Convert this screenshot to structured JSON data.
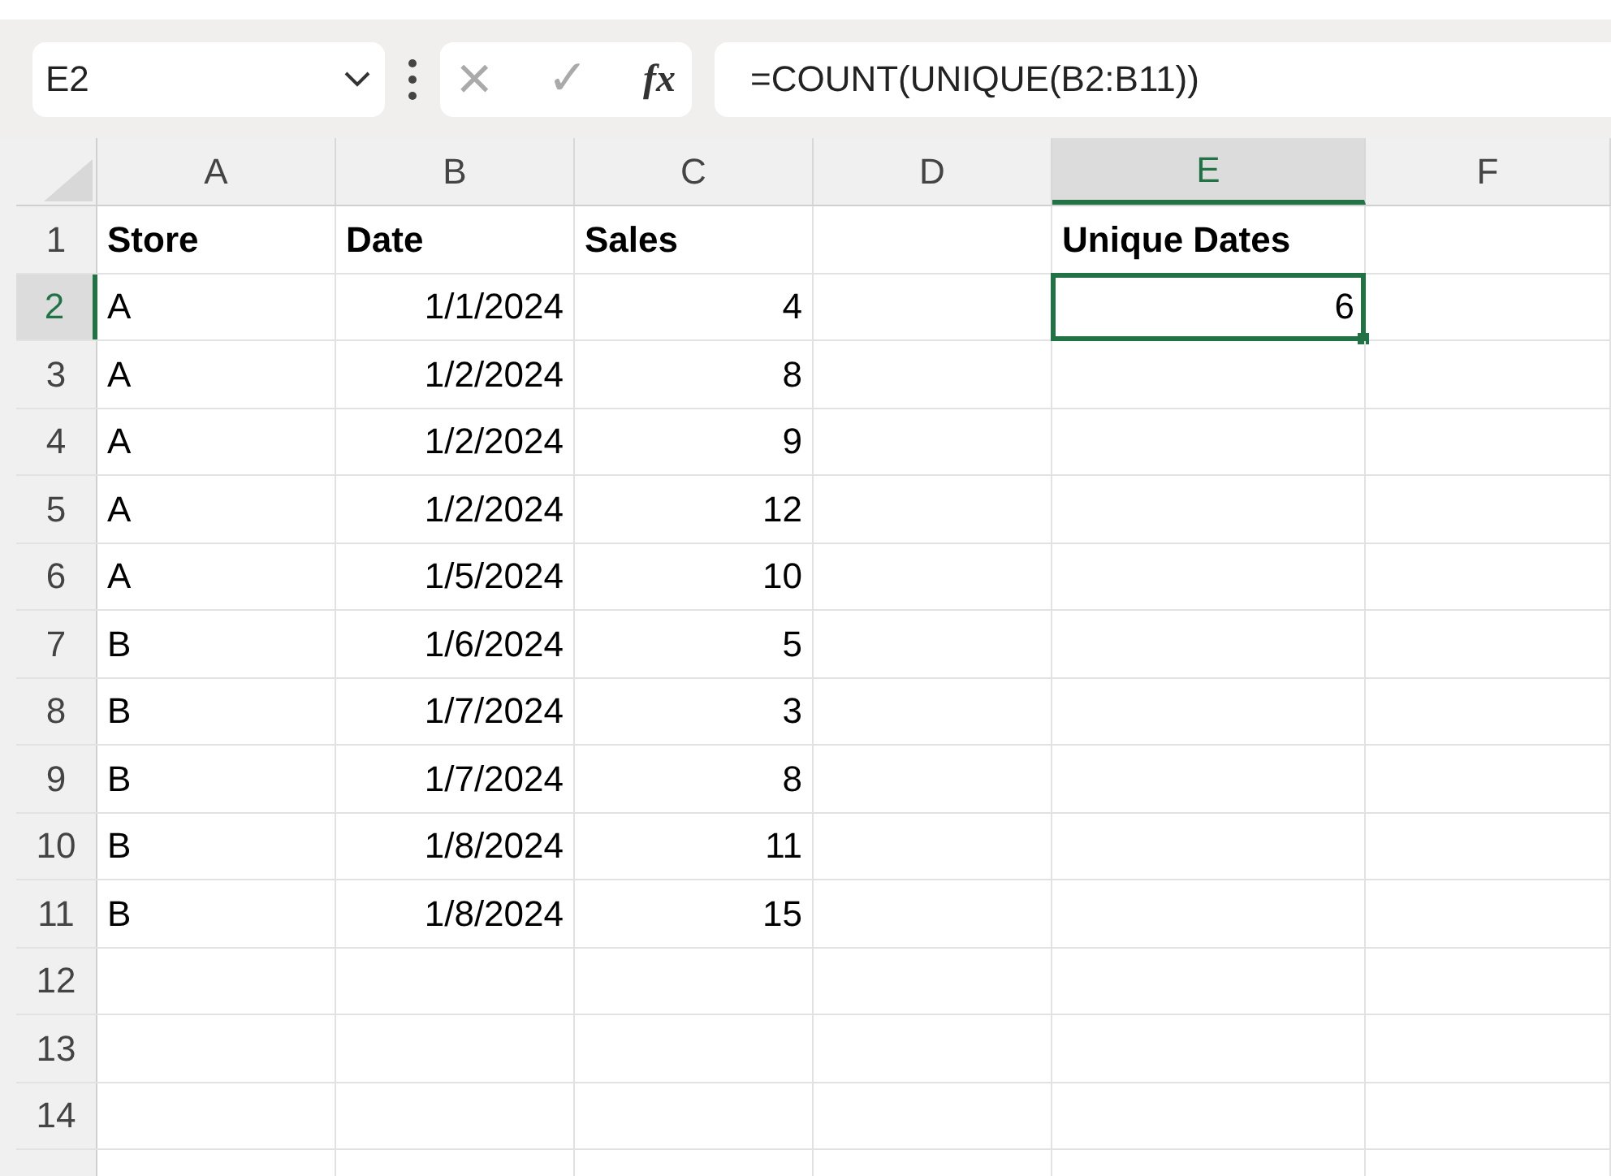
{
  "name_box": {
    "value": "E2"
  },
  "formula_bar": {
    "cancel": "×",
    "enter": "✓",
    "function": "fx",
    "value": "=COUNT(UNIQUE(B2:B11))"
  },
  "columns": [
    {
      "label": "A",
      "kind": "text",
      "selected": false
    },
    {
      "label": "B",
      "kind": "number",
      "selected": false
    },
    {
      "label": "C",
      "kind": "number",
      "selected": false
    },
    {
      "label": "D",
      "kind": "number",
      "selected": false
    },
    {
      "label": "E",
      "kind": "number",
      "selected": true
    },
    {
      "label": "F",
      "kind": "number",
      "selected": false
    }
  ],
  "rows": [
    {
      "number": "1",
      "kind": "header",
      "selected": false,
      "cells": [
        "Store",
        "Date",
        "Sales",
        null,
        "Unique Dates",
        null
      ]
    },
    {
      "number": "2",
      "kind": "data",
      "selected": true,
      "cells": [
        "A",
        "1/1/2024",
        "4",
        null,
        "6",
        null
      ]
    },
    {
      "number": "3",
      "kind": "data",
      "selected": false,
      "cells": [
        "A",
        "1/2/2024",
        "8",
        null,
        null,
        null
      ]
    },
    {
      "number": "4",
      "kind": "data",
      "selected": false,
      "cells": [
        "A",
        "1/2/2024",
        "9",
        null,
        null,
        null
      ]
    },
    {
      "number": "5",
      "kind": "data",
      "selected": false,
      "cells": [
        "A",
        "1/2/2024",
        "12",
        null,
        null,
        null
      ]
    },
    {
      "number": "6",
      "kind": "data",
      "selected": false,
      "cells": [
        "A",
        "1/5/2024",
        "10",
        null,
        null,
        null
      ]
    },
    {
      "number": "7",
      "kind": "data",
      "selected": false,
      "cells": [
        "B",
        "1/6/2024",
        "5",
        null,
        null,
        null
      ]
    },
    {
      "number": "8",
      "kind": "data",
      "selected": false,
      "cells": [
        "B",
        "1/7/2024",
        "3",
        null,
        null,
        null
      ]
    },
    {
      "number": "9",
      "kind": "data",
      "selected": false,
      "cells": [
        "B",
        "1/7/2024",
        "8",
        null,
        null,
        null
      ]
    },
    {
      "number": "10",
      "kind": "data",
      "selected": false,
      "cells": [
        "B",
        "1/8/2024",
        "11",
        null,
        null,
        null
      ]
    },
    {
      "number": "11",
      "kind": "data",
      "selected": false,
      "cells": [
        "B",
        "1/8/2024",
        "15",
        null,
        null,
        null
      ]
    },
    {
      "number": "12",
      "kind": "data",
      "selected": false,
      "cells": [
        null,
        null,
        null,
        null,
        null,
        null
      ]
    },
    {
      "number": "13",
      "kind": "data",
      "selected": false,
      "cells": [
        null,
        null,
        null,
        null,
        null,
        null
      ]
    },
    {
      "number": "14",
      "kind": "data",
      "selected": false,
      "cells": [
        null,
        null,
        null,
        null,
        null,
        null
      ]
    }
  ]
}
